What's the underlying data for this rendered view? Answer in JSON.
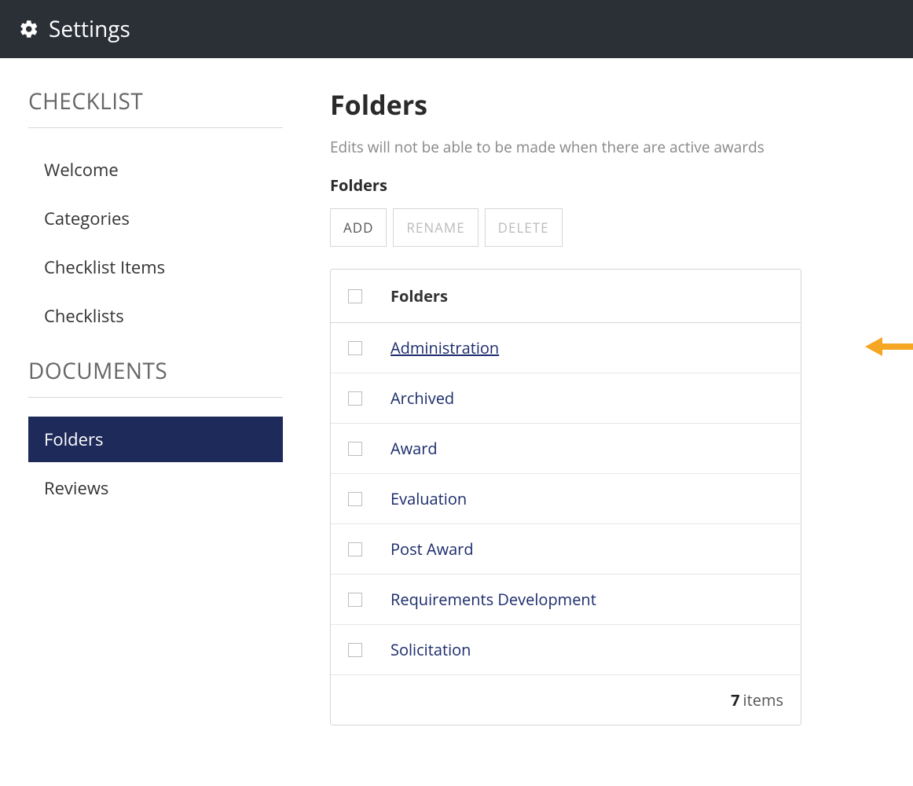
{
  "header": {
    "title": "Settings"
  },
  "sidebar": {
    "sections": [
      {
        "label": "CHECKLIST",
        "items": [
          {
            "label": "Welcome",
            "active": false
          },
          {
            "label": "Categories",
            "active": false
          },
          {
            "label": "Checklist Items",
            "active": false
          },
          {
            "label": "Checklists",
            "active": false
          }
        ]
      },
      {
        "label": "DOCUMENTS",
        "items": [
          {
            "label": "Folders",
            "active": true
          },
          {
            "label": "Reviews",
            "active": false
          }
        ]
      }
    ]
  },
  "main": {
    "title": "Folders",
    "note": "Edits will not be able to be made when there are active awards",
    "subheading": "Folders",
    "toolbar": {
      "add": "ADD",
      "rename": "RENAME",
      "delete": "DELETE"
    },
    "table": {
      "column_header": "Folders",
      "rows": [
        {
          "name": "Administration",
          "highlighted": true
        },
        {
          "name": "Archived",
          "highlighted": false
        },
        {
          "name": "Award",
          "highlighted": false
        },
        {
          "name": "Evaluation",
          "highlighted": false
        },
        {
          "name": "Post Award",
          "highlighted": false
        },
        {
          "name": "Requirements Development",
          "highlighted": false
        },
        {
          "name": "Solicitation",
          "highlighted": false
        }
      ],
      "footer": {
        "count": "7",
        "label": "items"
      }
    }
  },
  "annotation": {
    "arrow_target_row_index": 0
  }
}
